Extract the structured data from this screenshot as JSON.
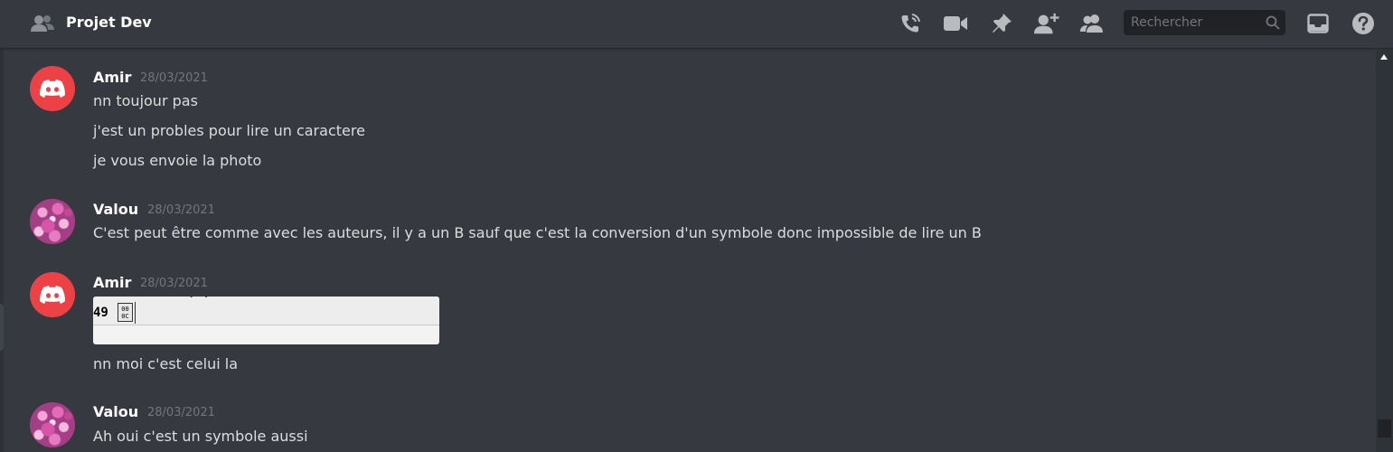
{
  "header": {
    "channel_title": "Projet Dev",
    "search_placeholder": "Rechercher",
    "icons": [
      "group-dm-icon",
      "voice-call-icon",
      "video-call-icon",
      "pin-icon",
      "add-member-icon",
      "member-list-icon",
      "search-icon",
      "inbox-icon",
      "help-icon"
    ]
  },
  "messages": [
    {
      "author": "Amir",
      "timestamp": "28/03/2021",
      "avatar": "discord-logo",
      "lines": [
        "nn toujour pas",
        "j'est un probles pour lire un caractere",
        "je vous envoie la photo"
      ]
    },
    {
      "author": "Valou",
      "timestamp": "28/03/2021",
      "avatar": "flowers-photo",
      "lines": [
        "C'est peut être comme avec les auteurs, il y a un B sauf que c'est la conversion d'un symbole donc impossible de lire un B"
      ]
    },
    {
      "author": "Amir",
      "timestamp": "28/03/2021",
      "avatar": "discord-logo",
      "attachment": {
        "cut_text": "   :  : ,  .",
        "code_text": "49",
        "glyph_text": "00 0C"
      },
      "lines": [
        "nn moi c'est celui la"
      ]
    },
    {
      "author": "Valou",
      "timestamp": "28/03/2021",
      "avatar": "flowers-photo",
      "lines": [
        "Ah oui c'est un symbole aussi"
      ]
    }
  ],
  "colors": {
    "background": "#36393f",
    "discord_red": "#ed4245",
    "header_icon": "#b9bbbe"
  }
}
